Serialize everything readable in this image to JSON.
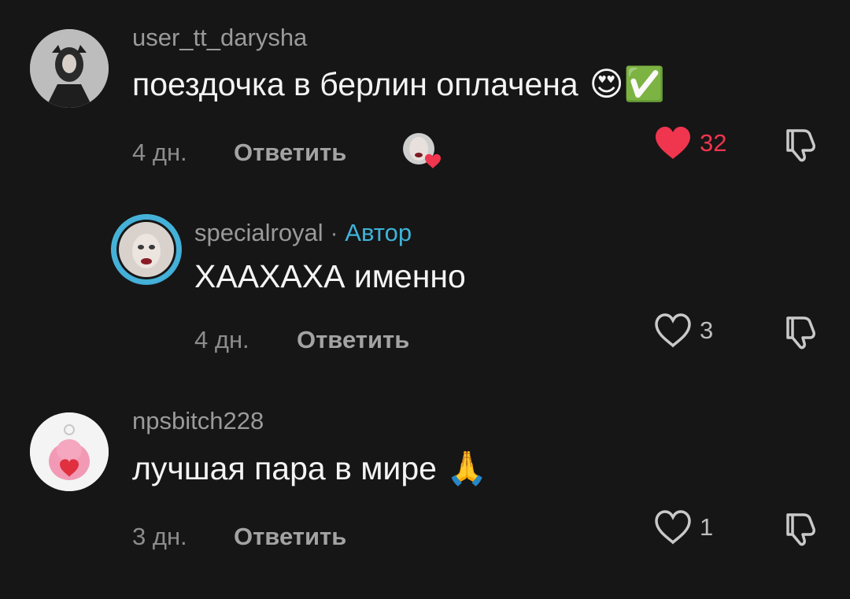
{
  "comments": [
    {
      "username": "user_tt_darysha",
      "text": "поездочка в берлин оплачена",
      "emoji": "😍✅",
      "time": "4 дн.",
      "reply_label": "Ответить",
      "likes": "32",
      "liked": true,
      "liked_by_author": true
    },
    {
      "username": "specialroyal",
      "separator": " · ",
      "author_tag": "Автор",
      "text": "ХААХАХА именно",
      "time": "4 дн.",
      "reply_label": "Ответить",
      "likes": "3",
      "liked": false
    },
    {
      "username": "npsbitch228",
      "text": "лучшая пара в мире",
      "emoji": "🙏",
      "time": "3 дн.",
      "reply_label": "Ответить",
      "likes": "1",
      "liked": false
    }
  ],
  "colors": {
    "background": "#161616",
    "like_red": "#f0354f",
    "author_blue": "#3fb3d9"
  }
}
